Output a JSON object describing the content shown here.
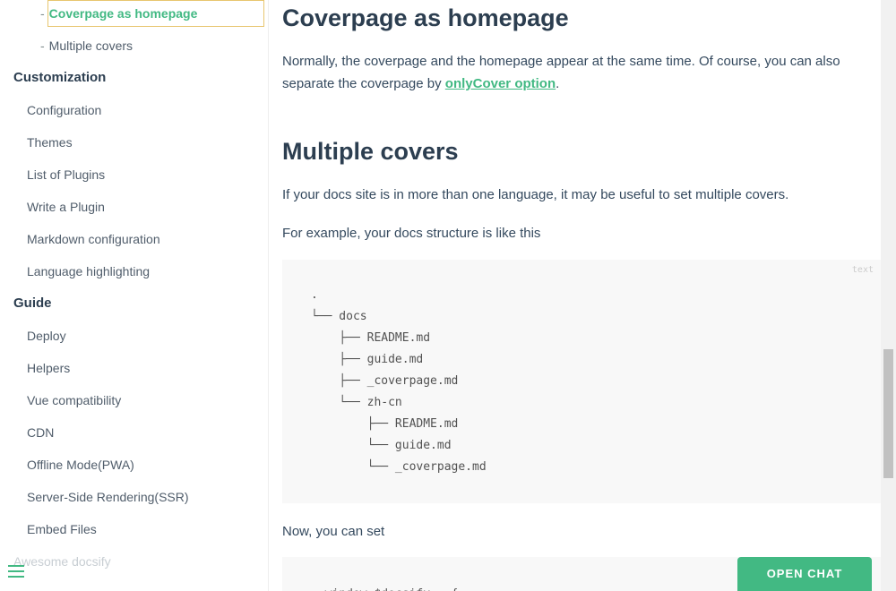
{
  "sidebar": {
    "sub_items": [
      {
        "label": "Coverpage as homepage",
        "active": true
      },
      {
        "label": "Multiple covers",
        "active": false
      }
    ],
    "sections": {
      "customization": "Customization",
      "guide": "Guide"
    },
    "customization_items": [
      "Configuration",
      "Themes",
      "List of Plugins",
      "Write a Plugin",
      "Markdown configuration",
      "Language highlighting"
    ],
    "guide_items": [
      "Deploy",
      "Helpers",
      "Vue compatibility",
      "CDN",
      "Offline Mode(PWA)",
      "Server-Side Rendering(SSR)",
      "Embed Files",
      "Awesome docsify"
    ],
    "dash": "-",
    "menu_icon": "hamburger-menu-icon"
  },
  "main": {
    "heading1": "Coverpage as homepage",
    "para1_before": "Normally, the coverpage and the homepage appear at the same time. Of course, you can also separate the coverpage by ",
    "para1_link": "onlyCover option",
    "para1_after": ".",
    "heading2": "Multiple covers",
    "para2": "If your docs site is in more than one language, it may be useful to set multiple covers.",
    "para3": "For example, your docs structure is like this",
    "code_lang": "text",
    "code_lines": [
      ".",
      "└── docs",
      "    ├── README.md",
      "    ├── guide.md",
      "    ├── _coverpage.md",
      "    └── zh-cn",
      "        ├── README.md",
      "        └── guide.md",
      "        └── _coverpage.md"
    ],
    "para4": "Now, you can set",
    "code2_partial": "  window.$docsify = {"
  },
  "chat": {
    "label": "OPEN CHAT",
    "color": "#42b983"
  },
  "colors": {
    "accent": "#42b983",
    "heading": "#2c3e50",
    "text": "#34495e"
  }
}
